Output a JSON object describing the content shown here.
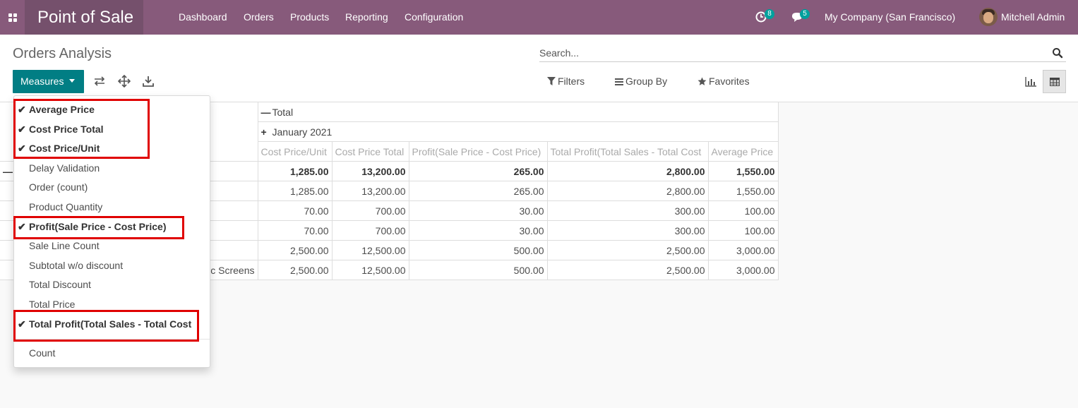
{
  "navbar": {
    "app_name": "Point of Sale",
    "menu": [
      "Dashboard",
      "Orders",
      "Products",
      "Reporting",
      "Configuration"
    ],
    "activity_count": "8",
    "message_count": "5",
    "company": "My Company (San Francisco)",
    "user": "Mitchell Admin"
  },
  "control_panel": {
    "title": "Orders Analysis",
    "search_placeholder": "Search...",
    "measures_label": "Measures",
    "filters_label": "Filters",
    "groupby_label": "Group By",
    "favorites_label": "Favorites"
  },
  "measures_menu": {
    "items": [
      {
        "label": "Average Price",
        "checked": true
      },
      {
        "label": "Cost Price Total",
        "checked": true
      },
      {
        "label": "Cost Price/Unit",
        "checked": true
      },
      {
        "label": "Delay Validation",
        "checked": false
      },
      {
        "label": "Order (count)",
        "checked": false
      },
      {
        "label": "Product Quantity",
        "checked": false
      },
      {
        "label": "Profit(Sale Price - Cost Price)",
        "checked": true
      },
      {
        "label": "Sale Line Count",
        "checked": false
      },
      {
        "label": "Subtotal w/o discount",
        "checked": false
      },
      {
        "label": "Total Discount",
        "checked": false
      },
      {
        "label": "Total Price",
        "checked": false
      },
      {
        "label": "Total Profit(Total Sales - Total Cost",
        "checked": true
      }
    ],
    "count_label": "Count"
  },
  "pivot": {
    "col_total": "Total",
    "col_group": "January 2021",
    "measures": [
      "Cost Price/Unit",
      "Cost Price Total",
      "Profit(Sale Price - Cost Price)",
      "Total Profit(Total Sales - Total Cost",
      "Average Price"
    ],
    "rows": [
      {
        "label": "",
        "bold": true,
        "values": [
          "1,285.00",
          "13,200.00",
          "265.00",
          "2,800.00",
          "1,550.00"
        ]
      },
      {
        "label": "",
        "bold": false,
        "values": [
          "1,285.00",
          "13,200.00",
          "265.00",
          "2,800.00",
          "1,550.00"
        ]
      },
      {
        "label": "",
        "bold": false,
        "values": [
          "70.00",
          "700.00",
          "30.00",
          "300.00",
          "100.00"
        ]
      },
      {
        "label": "",
        "bold": false,
        "values": [
          "70.00",
          "700.00",
          "30.00",
          "300.00",
          "100.00"
        ]
      },
      {
        "label": "",
        "bold": false,
        "values": [
          "2,500.00",
          "12,500.00",
          "500.00",
          "2,500.00",
          "3,000.00"
        ]
      },
      {
        "label": "c Screens",
        "bold": false,
        "values": [
          "2,500.00",
          "12,500.00",
          "500.00",
          "2,500.00",
          "3,000.00"
        ]
      }
    ]
  }
}
